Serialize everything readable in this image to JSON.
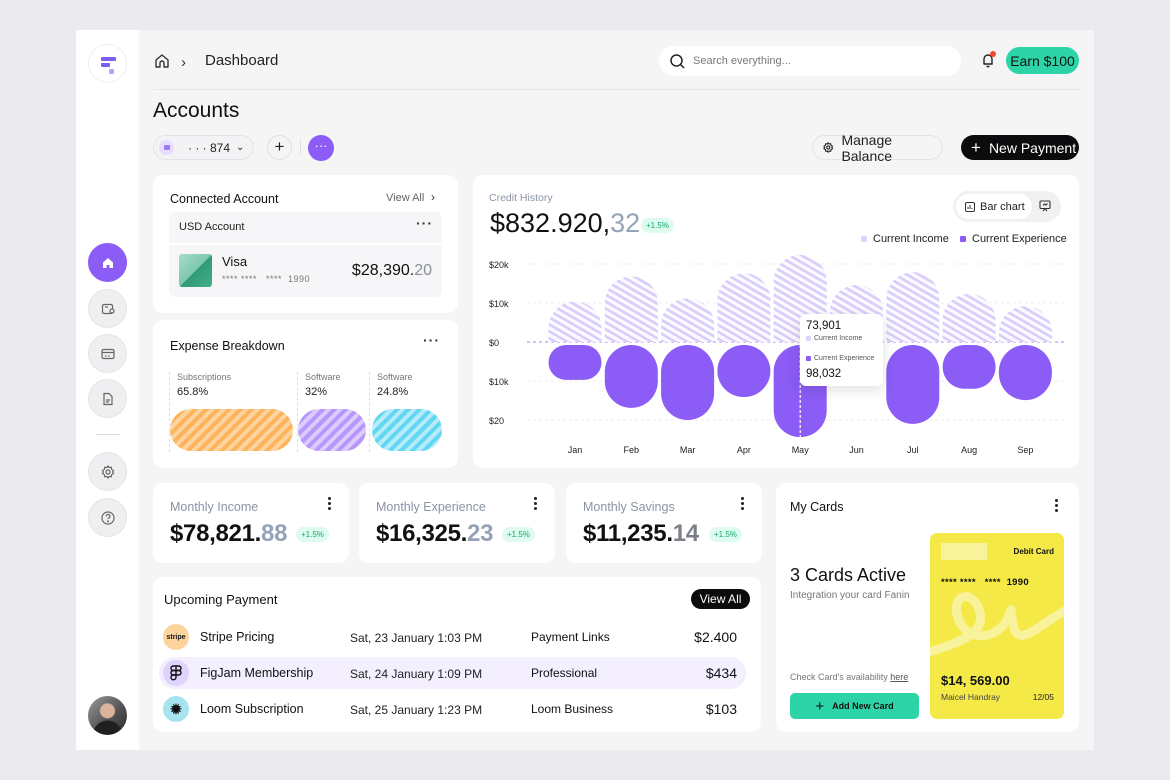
{
  "header": {
    "breadcrumb": "Dashboard",
    "search_placeholder": "Search everything...",
    "earn_label": "Earn $100"
  },
  "sidebar": {
    "items": [
      {
        "name": "home",
        "active": true
      },
      {
        "name": "wallet",
        "active": false
      },
      {
        "name": "cards",
        "active": false
      },
      {
        "name": "documents",
        "active": false
      },
      {
        "name": "settings",
        "active": false
      },
      {
        "name": "help",
        "active": false
      }
    ]
  },
  "page": {
    "title": "Accounts",
    "account_selector": "· · · 874",
    "more_label": "···",
    "manage_balance_label": "Manage Balance",
    "new_payment_label": "New Payment"
  },
  "connected_account": {
    "title": "Connected Account",
    "view_all": "View All",
    "account_name": "USD Account",
    "card_brand": "Visa",
    "card_number": "**** ****   ****  1990",
    "balance_main": "$28,390.",
    "balance_cents": "20"
  },
  "expense_breakdown": {
    "title": "Expense Breakdown",
    "items": [
      {
        "label": "Subscriptions",
        "percent": "65.8%",
        "color": "#fdb35c"
      },
      {
        "label": "Software",
        "percent": "32%",
        "color": "#b797fb"
      },
      {
        "label": "Software",
        "percent": "24.8%",
        "color": "#62d6f3"
      }
    ]
  },
  "credit_history": {
    "label": "Credit History",
    "amount_main": "$832.920,",
    "amount_cents": "32",
    "change": "+1.5%",
    "view_toggle": {
      "active": "Bar chart"
    },
    "tooltip": {
      "income_value": "73,901",
      "income_label": "Current Income",
      "experience_label": "Current Experience",
      "experience_value": "98,032"
    }
  },
  "chart_data": {
    "type": "bar",
    "title": "Credit History",
    "categories": [
      "Jan",
      "Feb",
      "Mar",
      "Apr",
      "May",
      "Jun",
      "Jul",
      "Aug",
      "Sep"
    ],
    "series": [
      {
        "name": "Current Income",
        "color": "#d6c8fb",
        "direction": "up",
        "values": [
          10.4,
          16.8,
          11.2,
          17.6,
          22.3,
          14.6,
          17.9,
          12.3,
          9.2
        ]
      },
      {
        "name": "Current Experience",
        "color": "#8b5cf6",
        "direction": "down",
        "values": [
          9.7,
          16.9,
          20.0,
          14.1,
          24.4,
          0,
          21.0,
          12.0,
          14.9
        ]
      }
    ],
    "y_ticks": [
      "$20k",
      "$10k",
      "$0",
      "$10k",
      "$20"
    ],
    "ylim": [
      -20,
      20
    ],
    "y_unit": "thousands USD",
    "legend": "top-right",
    "grid": true,
    "highlighted_category": "May"
  },
  "stats": [
    {
      "label": "Monthly Income",
      "main": "$78,821.",
      "cents": "88",
      "change": "+1.5%"
    },
    {
      "label": "Monthly Experience",
      "main": "$16,325.",
      "cents": "23",
      "change": "+1.5%"
    },
    {
      "label": "Monthly Savings",
      "main": "$11,235.",
      "cents": "14",
      "change": "+1.5%"
    }
  ],
  "my_cards": {
    "title": "My Cards",
    "active_count": "3 Cards Active",
    "subtitle": "Integration your card Fanin",
    "check_text": "Check Card's availability ",
    "check_link": "here",
    "add_label": "Add New Card",
    "card": {
      "type": "Debit Card",
      "number": "**** ****   ****  1990",
      "balance": "$14, 569.00",
      "holder": "Maicel Handray",
      "expiry": "12/05"
    }
  },
  "upcoming_payment": {
    "title": "Upcoming Payment",
    "view_all": "View All",
    "rows": [
      {
        "logo": "stripe",
        "name": "Stripe Pricing",
        "date": "Sat, 23 January 1:03 PM",
        "category": "Payment Links",
        "amount": "$2.400",
        "highlight": false
      },
      {
        "logo": "figma",
        "name": "FigJam Membership",
        "date": "Sat, 24 January 1:09 PM",
        "category": "Professional",
        "amount": "$434",
        "highlight": true
      },
      {
        "logo": "loom",
        "name": "Loom Subscription",
        "date": "Sat, 25 January 1:23 PM",
        "category": "Loom Business",
        "amount": "$103",
        "highlight": false
      }
    ]
  }
}
